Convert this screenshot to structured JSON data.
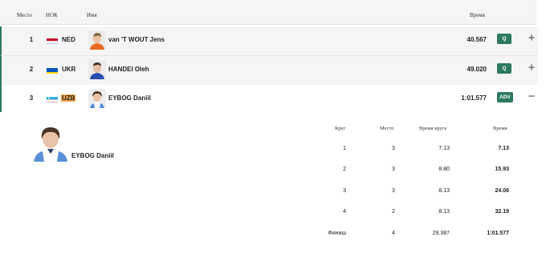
{
  "header": {
    "rank": "Место",
    "noc": "НОК",
    "name": "Имя",
    "time": "Время"
  },
  "results": [
    {
      "rank": "1",
      "noc": "NED",
      "name": "van 'T WOUT Jens",
      "time": "40.567",
      "badge": "Q",
      "toggle": "+"
    },
    {
      "rank": "2",
      "noc": "UKR",
      "name": "HANDEI Oleh",
      "time": "49.020",
      "badge": "Q",
      "toggle": "+"
    },
    {
      "rank": "3",
      "noc": "UZB",
      "name": "EYBOG Daniil",
      "time": "1:01.577",
      "badge": "ADV",
      "toggle": "−"
    }
  ],
  "detail": {
    "athlete_name": "EYBOG Daniil",
    "columns": {
      "lap": "Круг",
      "place": "Место",
      "lap_time": "Время круга",
      "time": "Время"
    },
    "splits": [
      {
        "lap": "1",
        "place": "3",
        "lap_time": "7.13",
        "time": "7.13"
      },
      {
        "lap": "2",
        "place": "3",
        "lap_time": "8.80",
        "time": "15.93"
      },
      {
        "lap": "3",
        "place": "3",
        "lap_time": "8.13",
        "time": "24.06"
      },
      {
        "lap": "4",
        "place": "2",
        "lap_time": "8.13",
        "time": "32.19"
      },
      {
        "lap": "Финиш",
        "place": "4",
        "lap_time": "29.387",
        "time": "1:01.577"
      }
    ]
  },
  "colors": {
    "accent": "#2d7a5e",
    "highlight": "#f0a64a",
    "row_bg": "#f4f5f4"
  }
}
